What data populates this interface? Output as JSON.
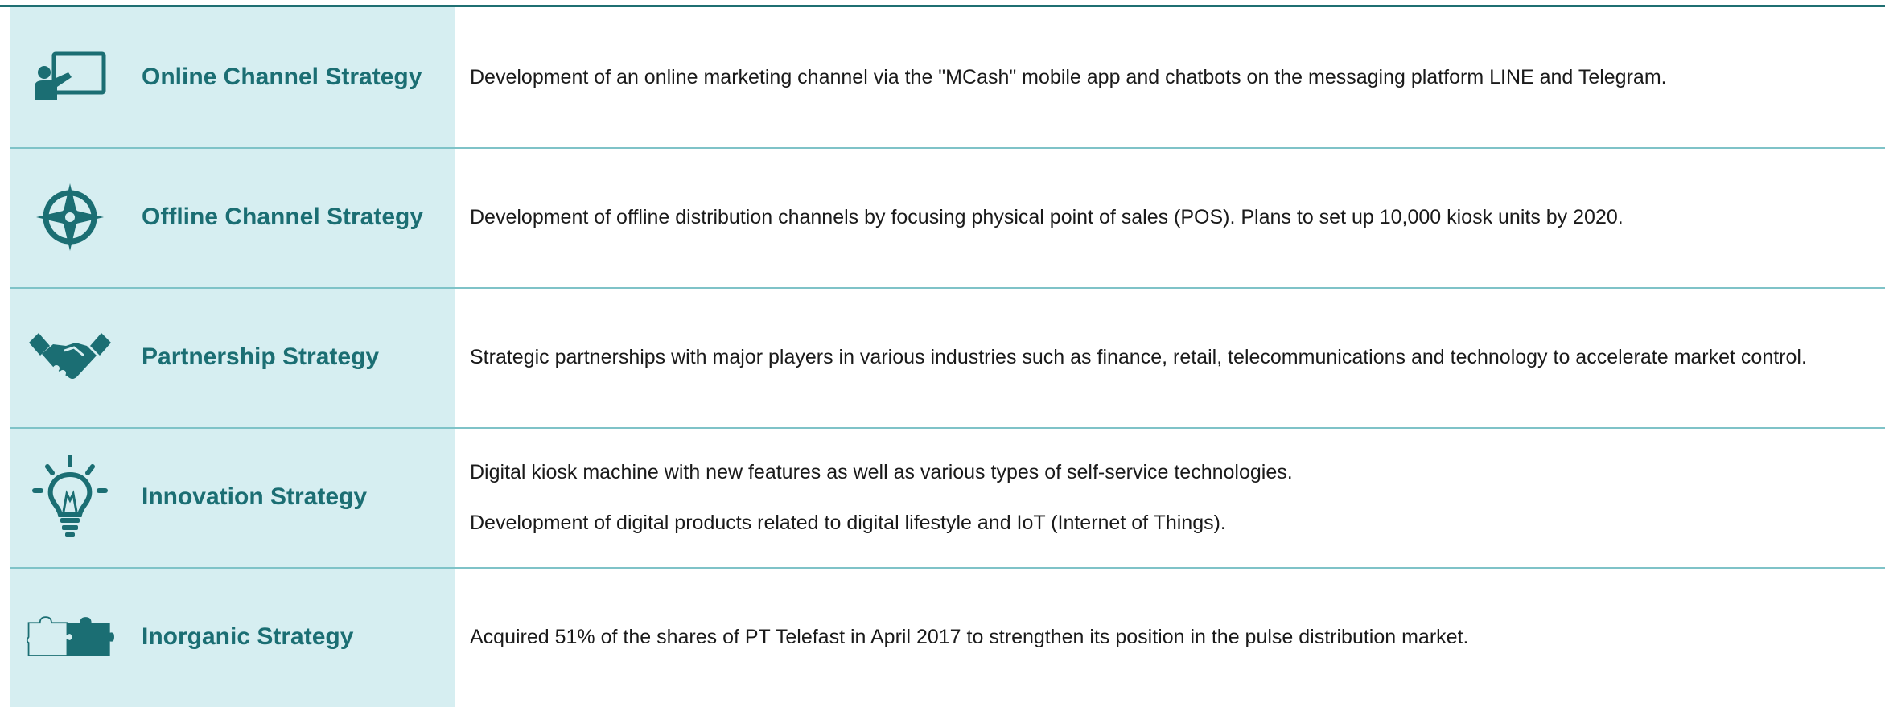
{
  "strategies": [
    {
      "title": "Online Channel Strategy",
      "icon": "presentation-board-icon",
      "descriptions": [
        "Development of an online marketing channel via the \"MCash\" mobile app and chatbots on the messaging platform LINE and Telegram."
      ]
    },
    {
      "title": "Offline Channel Strategy",
      "icon": "compass-icon",
      "descriptions": [
        "Development of offline distribution channels by focusing physical point of sales (POS). Plans to set up 10,000 kiosk units by 2020."
      ]
    },
    {
      "title": "Partnership Strategy",
      "icon": "handshake-icon",
      "descriptions": [
        "Strategic partnerships with major players in various industries such as finance, retail, telecommunications and technology to accelerate market control."
      ]
    },
    {
      "title": "Innovation Strategy",
      "icon": "lightbulb-icon",
      "descriptions": [
        "Digital kiosk machine with new features as well as various types of self-service technologies.",
        "Development of digital products related to digital lifestyle and IoT (Internet of Things)."
      ]
    },
    {
      "title": "Inorganic Strategy",
      "icon": "puzzle-pieces-icon",
      "descriptions": [
        "Acquired 51% of the shares of PT Telefast in April 2017 to strengthen its position in the pulse distribution market."
      ]
    }
  ],
  "colors": {
    "accent": "#1b6e73",
    "left_panel": "#d6eef1",
    "divider": "#7fc3c8"
  }
}
